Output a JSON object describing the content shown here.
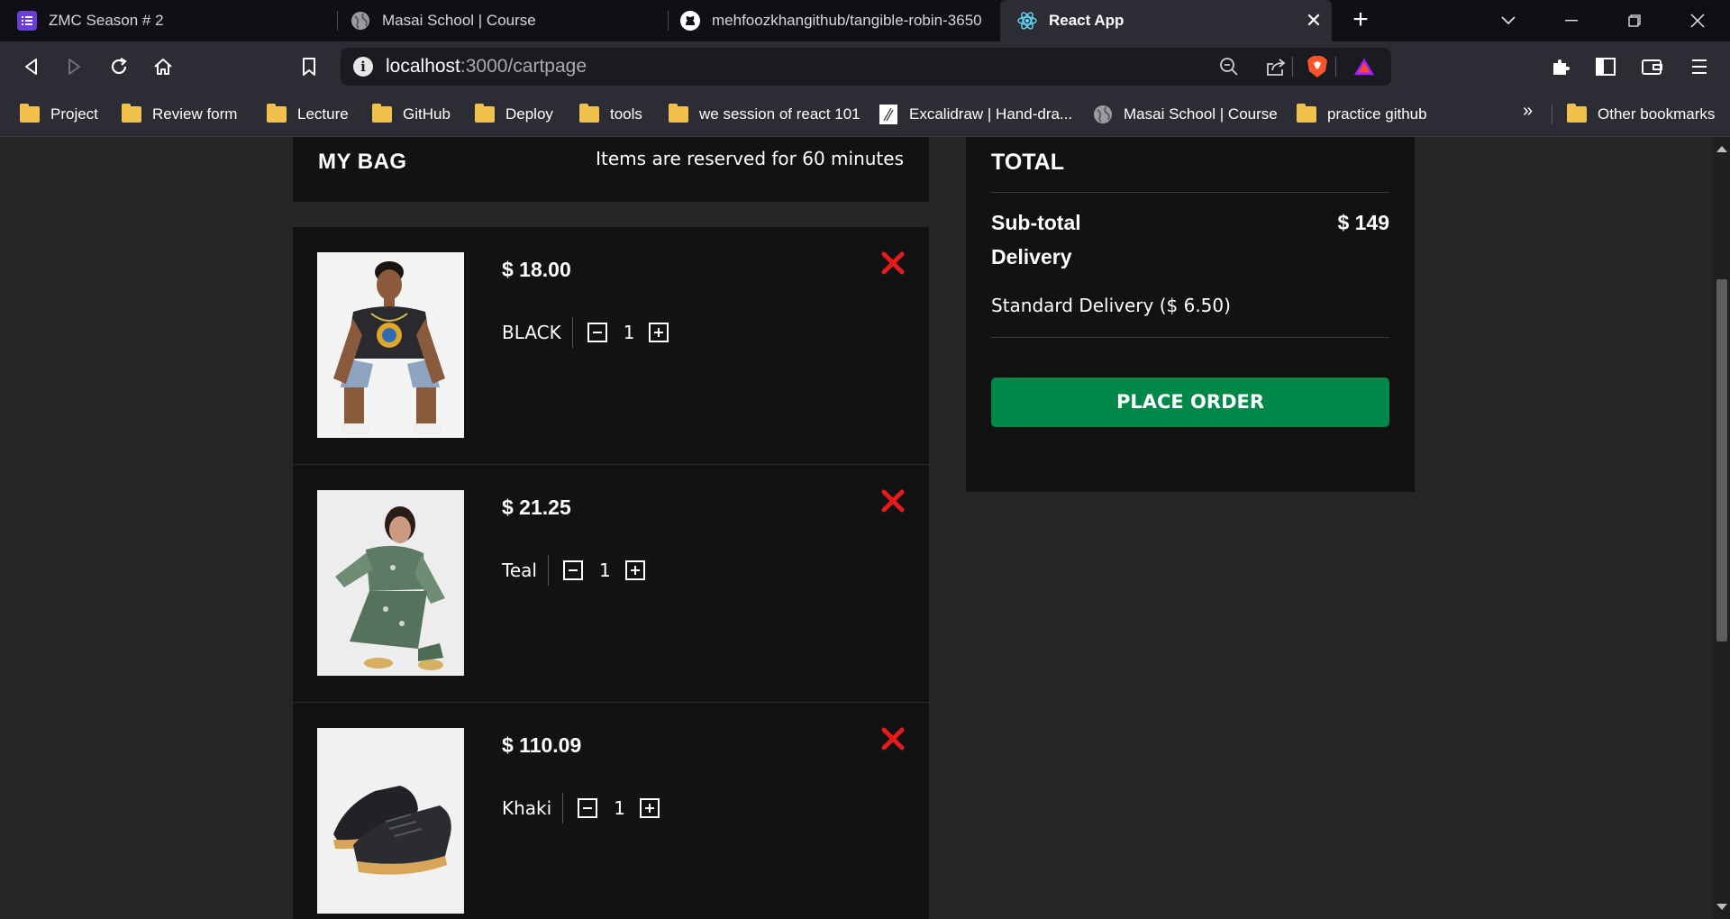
{
  "browser": {
    "tabs": [
      {
        "title": "ZMC Season # 2",
        "icon": "list-icon",
        "active": false
      },
      {
        "title": "Masai School | Course",
        "icon": "globe-icon",
        "active": false
      },
      {
        "title": "mehfoozkhangithub/tangible-robin-3650",
        "icon": "github-icon",
        "active": false
      },
      {
        "title": "React App",
        "icon": "react-icon",
        "active": true
      }
    ],
    "address": {
      "host": "localhost",
      "path": ":3000/cartpage"
    },
    "bookmarks": [
      {
        "label": "Project",
        "icon": "folder-icon"
      },
      {
        "label": "Review form",
        "icon": "folder-icon"
      },
      {
        "label": "Lecture",
        "icon": "folder-icon"
      },
      {
        "label": "GitHub",
        "icon": "folder-icon"
      },
      {
        "label": "Deploy",
        "icon": "folder-icon"
      },
      {
        "label": "tools",
        "icon": "folder-icon"
      },
      {
        "label": "we session of react 101",
        "icon": "folder-icon"
      },
      {
        "label": "Excalidraw | Hand-dra...",
        "icon": "excalidraw-icon"
      },
      {
        "label": "Masai School | Course",
        "icon": "globe-icon"
      },
      {
        "label": "practice github",
        "icon": "folder-icon"
      }
    ],
    "more_bookmarks": "»",
    "other_bookmarks": "Other bookmarks"
  },
  "bag": {
    "title": "MY BAG",
    "note": "Items are reserved for 60 minutes",
    "items": [
      {
        "price": "$ 18.00",
        "color": "BLACK",
        "quantity": "1"
      },
      {
        "price": "$ 21.25",
        "color": "Teal",
        "quantity": "1"
      },
      {
        "price": "$ 110.09",
        "color": "Khaki",
        "quantity": "1"
      }
    ]
  },
  "total": {
    "title": "TOTAL",
    "subtotal_label": "Sub-total",
    "subtotal_value": "$ 149",
    "delivery_label": "Delivery",
    "delivery_option": "Standard Delivery ($ 6.50)",
    "place_order": "PLACE ORDER"
  },
  "colors": {
    "page_bg": "#262626",
    "panel_bg": "#121212",
    "accent_green": "#018849",
    "remove_red": "#e51b1b"
  }
}
